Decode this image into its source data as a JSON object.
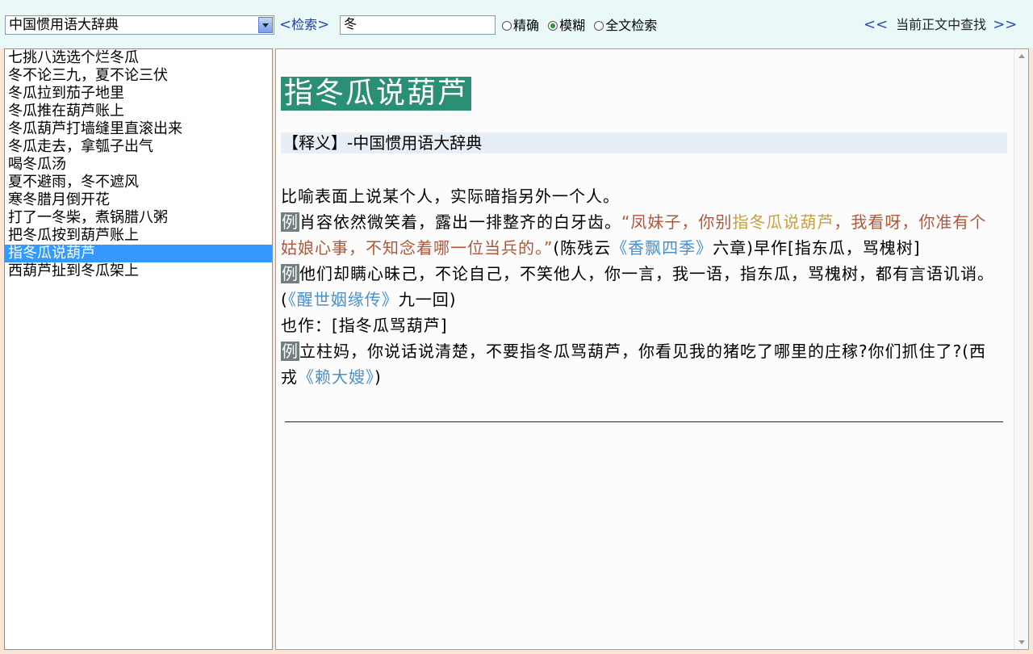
{
  "toolbar": {
    "dictionary": "中国惯用语大辞典",
    "search_label": "检索",
    "search_value": "冬",
    "modes": [
      "精确",
      "模糊",
      "全文检索"
    ],
    "selected_mode": "模糊",
    "find_label": "当前正文中查找",
    "prev_arrow": "<<",
    "next_arrow": ">>"
  },
  "list": {
    "items": [
      "七挑八选选个烂冬瓜",
      "冬不论三九，夏不论三伏",
      "冬瓜拉到茄子地里",
      "冬瓜推在葫芦账上",
      "冬瓜葫芦打墙缝里直滚出来",
      "冬瓜走去，拿瓠子出气",
      "喝冬瓜汤",
      "夏不避雨，冬不遮风",
      "寒冬腊月倒开花",
      "打了一冬柴，煮锅腊八粥",
      "把冬瓜按到葫芦账上",
      "指冬瓜说葫芦",
      "西葫芦扯到冬瓜架上"
    ],
    "selected_index": 11
  },
  "entry": {
    "title": "指冬瓜说葫芦",
    "def_header": "【释义】-中国惯用语大辞典",
    "meaning": "比喻表面上说某个人，实际暗指另外一个人。",
    "example_tag": "例",
    "ex1_text": "肖容依然微笑着，露出一排整齐的白牙齿。",
    "ex1_quote_a": "“凤妹子，你别",
    "ex1_quote_hl": "指冬瓜说葫芦",
    "ex1_quote_b": "，我看呀，你准有个姑娘心事，不知念着哪一位当兵的。”",
    "ex1_src_pre": "(陈残云",
    "ex1_src": "《香飘四季》",
    "ex1_src_post": "六章)早作[指东瓜，骂槐树]",
    "ex2_text": "他们却瞒心昧己，不论自己，不笑他人，你一言，我一语，指东瓜，骂槐树，都有言语讥诮。(",
    "ex2_src": "《醒世姻缘传》",
    "ex2_src_post": "九一回)",
    "alt_form": "也作：[指冬瓜骂葫芦]",
    "ex3_text": "立柱妈，你说话说清楚，不要指冬瓜骂葫芦，你看见我的猪吃了哪里的庄稼?你们抓住了?(西戎",
    "ex3_src": "《赖大嫂》",
    "ex3_src_post": ")"
  },
  "colors": {
    "title_bg": "#2a8f75",
    "selected_bg": "#3399ff",
    "quote": "#b0573a",
    "quote_highlight": "#c8a040",
    "source_link": "#4a90c8"
  }
}
